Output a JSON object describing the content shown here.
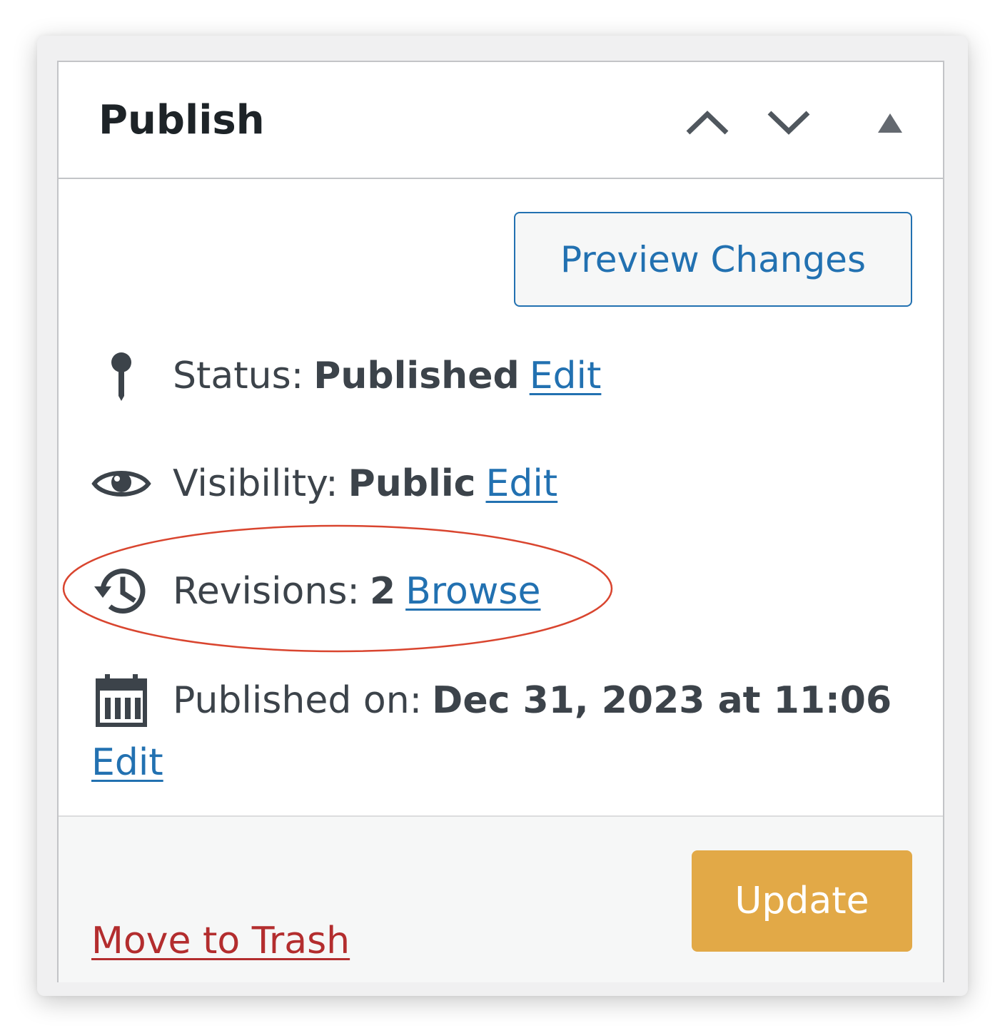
{
  "publish_box": {
    "title": "Publish",
    "header_icons": {
      "move_up": "chevron-up-icon",
      "move_down": "chevron-down-icon",
      "toggle": "triangle-up-icon"
    },
    "preview_label": "Preview Changes",
    "status": {
      "icon": "pin-icon",
      "label": "Status:",
      "value": "Published",
      "link": "Edit"
    },
    "visibility": {
      "icon": "eye-icon",
      "label": "Visibility:",
      "value": "Public",
      "link": "Edit"
    },
    "revisions": {
      "icon": "history-icon",
      "label": "Revisions:",
      "value": "2",
      "link": "Browse",
      "highlighted": true
    },
    "published_on": {
      "icon": "calendar-icon",
      "label": "Published on:",
      "value": "Dec 31, 2023 at 11:06",
      "link": "Edit"
    },
    "footer": {
      "trash_label": "Move to Trash",
      "update_label": "Update"
    }
  },
  "colors": {
    "link": "#2271b1",
    "trash": "#b32d2e",
    "update_button": "#e2a947",
    "highlight_ring": "#d9452f",
    "text": "#3c434a",
    "border": "#c3c4c7"
  }
}
